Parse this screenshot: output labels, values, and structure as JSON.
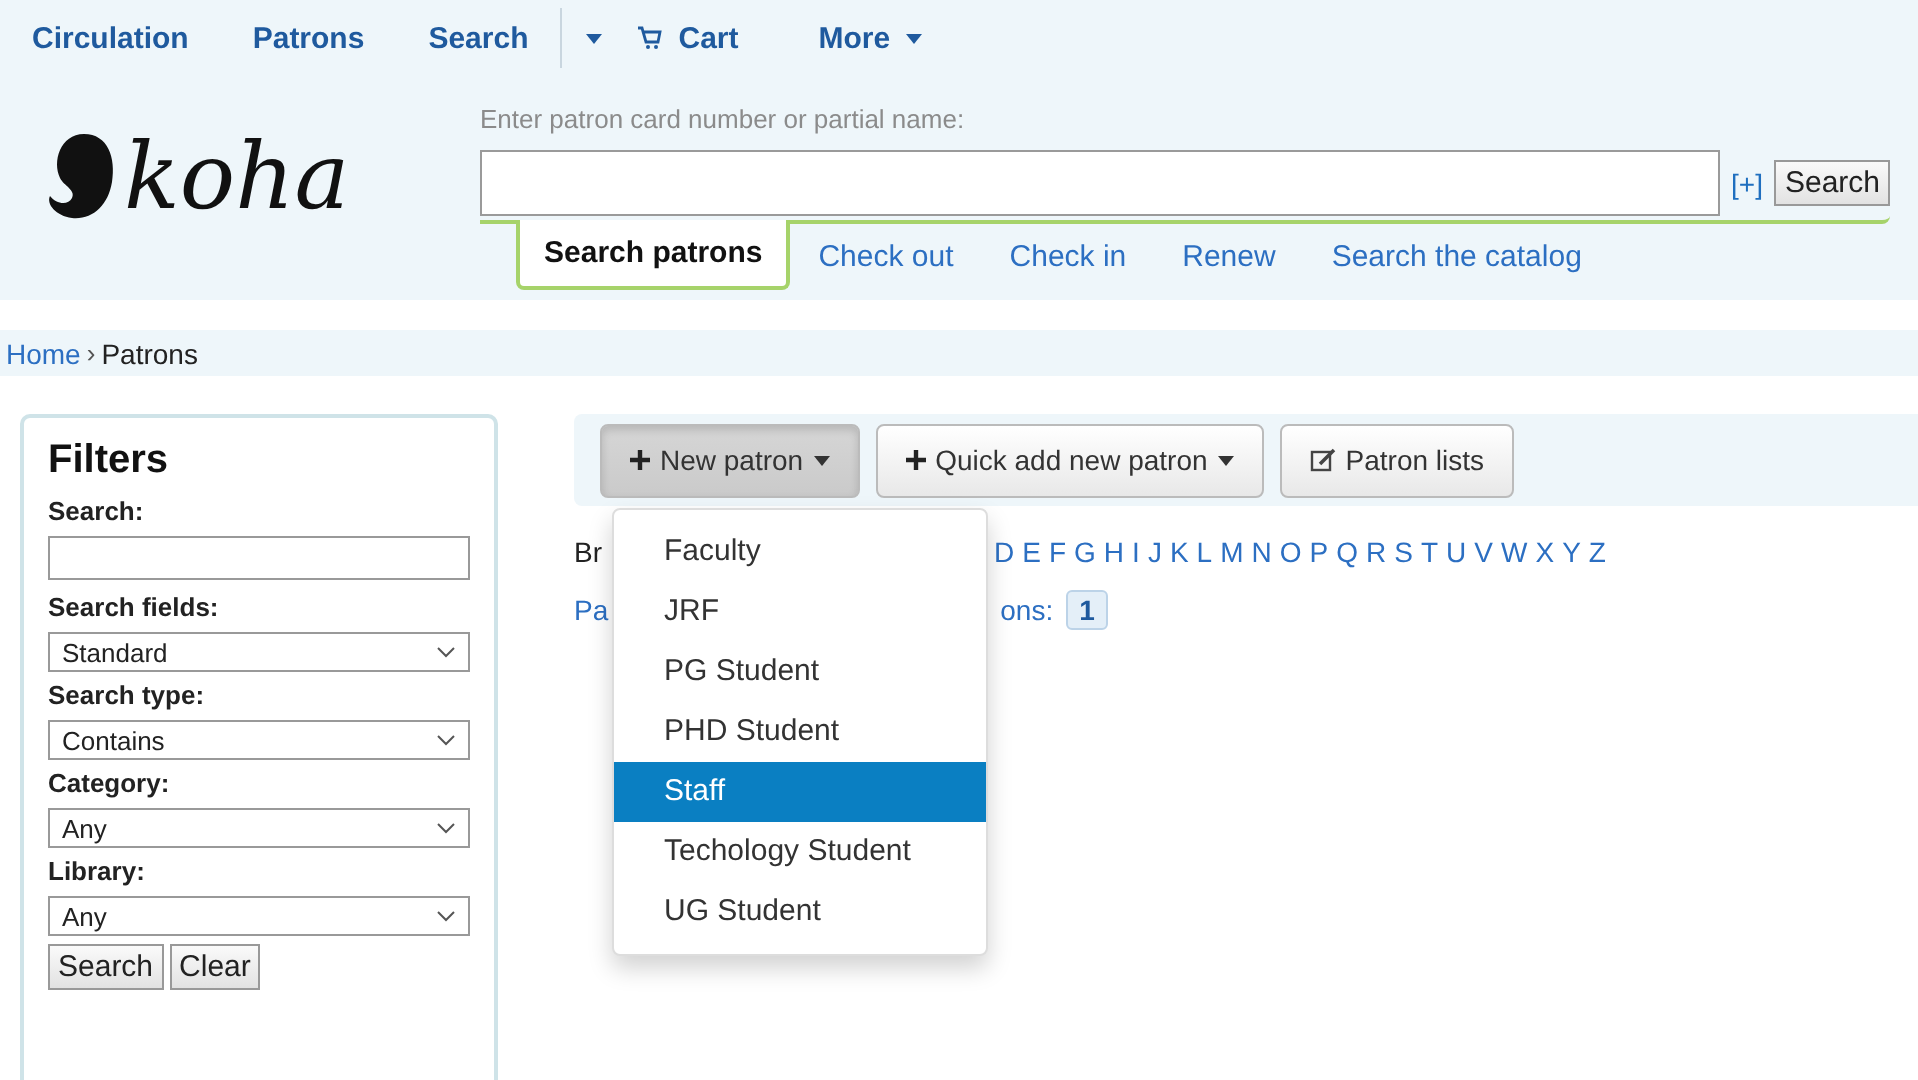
{
  "top_nav": [
    {
      "label": "Circulation",
      "kind": "link"
    },
    {
      "label": "Patrons",
      "kind": "link"
    },
    {
      "label": "Search",
      "kind": "link"
    },
    {
      "label": "Cart",
      "kind": "cart"
    },
    {
      "label": "More",
      "kind": "menu"
    }
  ],
  "logo": {
    "text": "koha"
  },
  "patron_search": {
    "label": "Enter patron card number or partial name:",
    "expand": "[+]",
    "button": "Search"
  },
  "header_tabs": [
    {
      "label": "Search patrons",
      "selected": true
    },
    {
      "label": "Check out",
      "selected": false
    },
    {
      "label": "Check in",
      "selected": false
    },
    {
      "label": "Renew",
      "selected": false
    },
    {
      "label": "Search the catalog",
      "selected": false
    }
  ],
  "breadcrumb": {
    "separator": "›",
    "items": [
      {
        "label": "Home",
        "kind": "link"
      },
      {
        "label": "Patrons",
        "kind": "current"
      }
    ]
  },
  "filters": {
    "title": "Filters",
    "fields": [
      {
        "label": "Search:",
        "kind": "text"
      },
      {
        "label": "Search fields:",
        "kind": "select",
        "value": "Standard"
      },
      {
        "label": "Search type:",
        "kind": "select",
        "value": "Contains"
      },
      {
        "label": "Category:",
        "kind": "select",
        "value": "Any"
      },
      {
        "label": "Library:",
        "kind": "select",
        "value": "Any"
      }
    ],
    "buttons": [
      "Search",
      "Clear"
    ]
  },
  "toolbar": [
    {
      "label": "New patron",
      "kind": "plus-dropdown",
      "pressed": true
    },
    {
      "label": "Quick add new patron",
      "kind": "plus-dropdown",
      "pressed": false
    },
    {
      "label": "Patron lists",
      "kind": "edit",
      "pressed": false
    }
  ],
  "browse": {
    "label": "Br",
    "letters": [
      "D",
      "E",
      "F",
      "G",
      "H",
      "I",
      "J",
      "K",
      "L",
      "M",
      "N",
      "O",
      "P",
      "Q",
      "R",
      "S",
      "T",
      "U",
      "V",
      "W",
      "X",
      "Y",
      "Z"
    ]
  },
  "pages": {
    "label_start": "Pa",
    "label_end": "ons:",
    "items": [
      {
        "label": "1",
        "selected": true
      }
    ]
  },
  "new_patron_menu": [
    {
      "label": "Faculty",
      "selected": false
    },
    {
      "label": "JRF",
      "selected": false
    },
    {
      "label": "PG Student",
      "selected": false
    },
    {
      "label": "PHD Student",
      "selected": false
    },
    {
      "label": "Staff",
      "selected": true
    },
    {
      "label": "Techology Student",
      "selected": false
    },
    {
      "label": "UG Student",
      "selected": false
    }
  ]
}
